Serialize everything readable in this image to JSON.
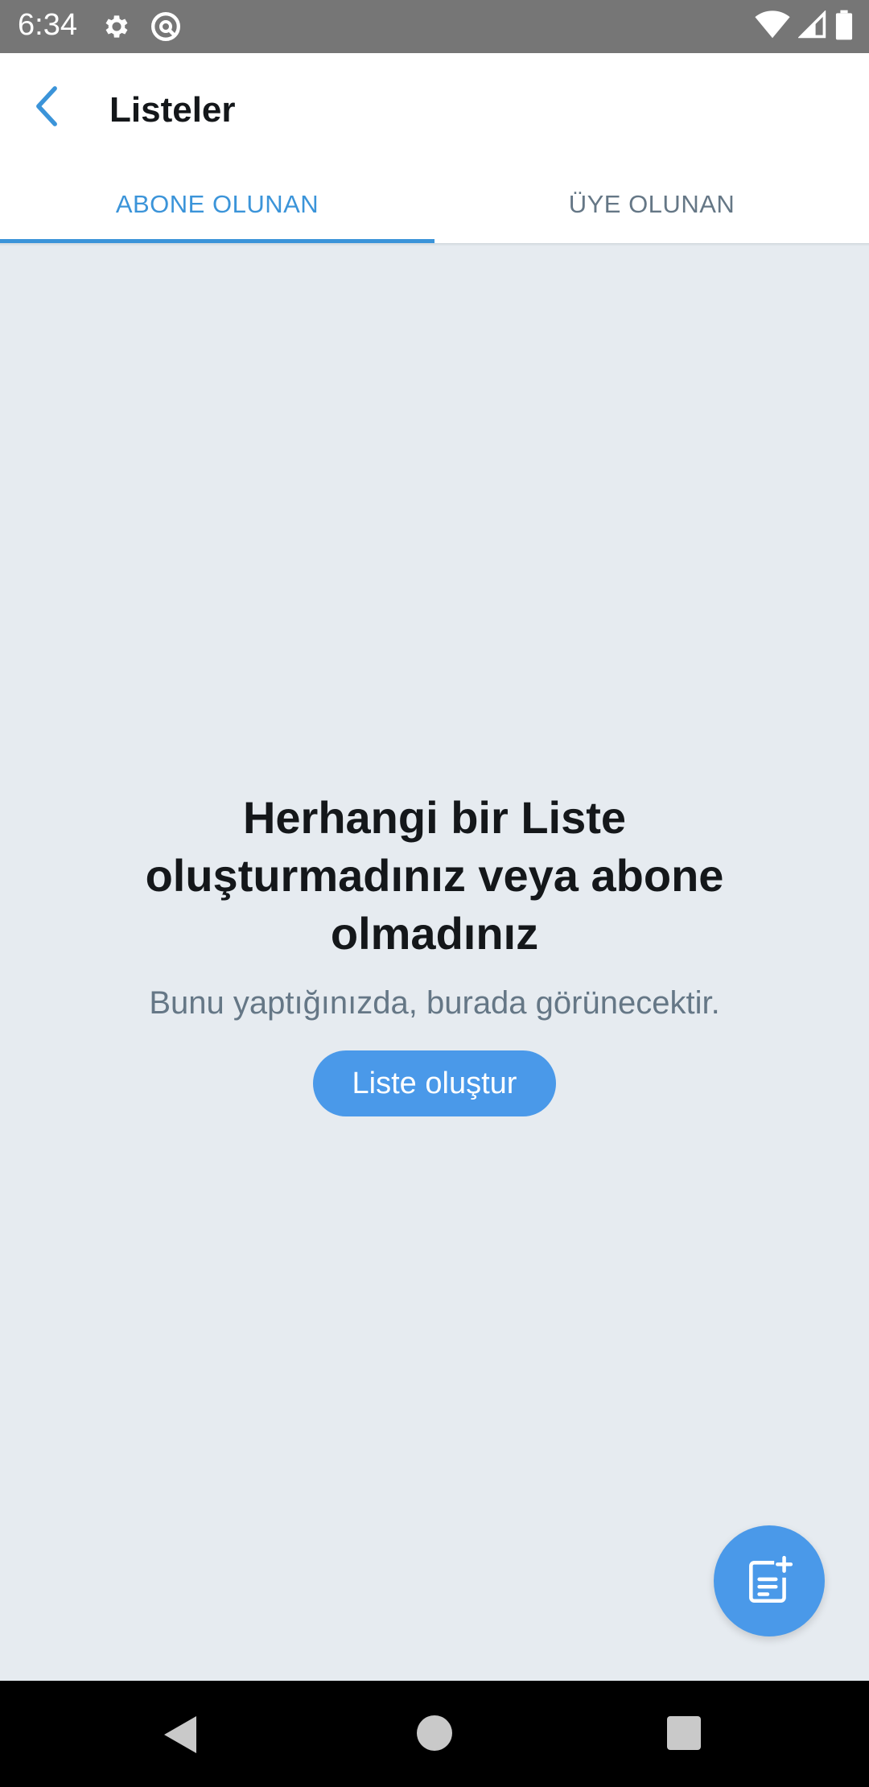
{
  "status_bar": {
    "time": "6:34",
    "icons": [
      "settings-gear-icon",
      "at-sign-icon",
      "wifi-icon",
      "cellular-signal-icon",
      "battery-icon"
    ]
  },
  "header": {
    "back_icon": "chevron-left-icon",
    "title": "Listeler"
  },
  "tabs": [
    {
      "label": "ABONE OLUNAN",
      "active": true
    },
    {
      "label": "ÜYE OLUNAN",
      "active": false
    }
  ],
  "empty_state": {
    "title": "Herhangi bir Liste oluşturmadınız veya abone olmadınız",
    "subtitle": "Bunu yaptığınızda, burada görünecektir.",
    "button_label": "Liste oluştur"
  },
  "fab": {
    "icon": "new-list-icon"
  },
  "colors": {
    "accent": "#3b94d9",
    "button": "#4a99e9",
    "background": "#e6ebf0",
    "status_bar": "#767676"
  },
  "nav_bar": {
    "icons": [
      "nav-back-triangle-icon",
      "nav-home-circle-icon",
      "nav-recents-square-icon"
    ]
  }
}
